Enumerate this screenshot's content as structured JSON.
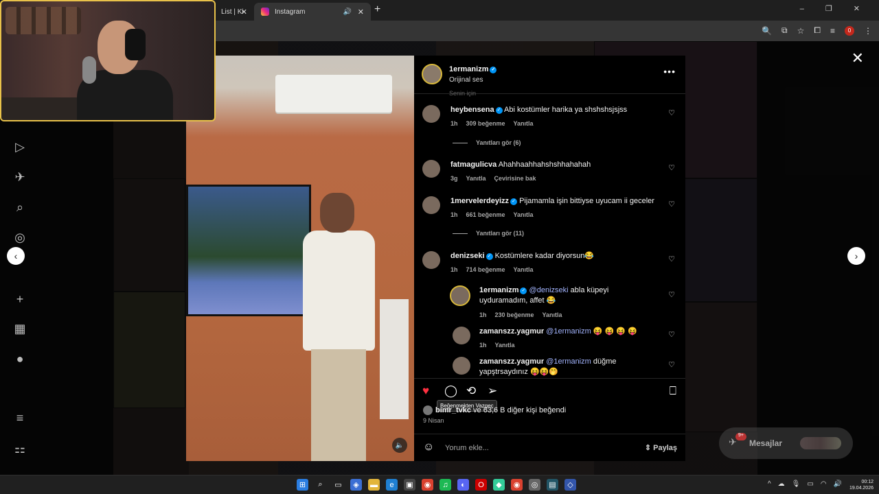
{
  "browser": {
    "tabs": [
      {
        "label": "List | Ki",
        "active": false
      },
      {
        "label": "Instagram",
        "active": true
      }
    ],
    "new_tab": "+",
    "window_controls": "– ❐ ✕",
    "profile_badge": "0"
  },
  "post": {
    "author": "1ermanizm",
    "audio": "Orijinal ses",
    "cut_text": "Senin için",
    "comments": [
      {
        "user": "heybensena",
        "verified": true,
        "text": "Abi kostümler harika ya shshshsjsjss",
        "time": "1h",
        "likes": "309 beğenme",
        "reply": "Yanıtla"
      },
      {
        "replies": "Yanıtları gör (6)"
      },
      {
        "user": "fatmagulicva",
        "verified": false,
        "text": "Ahahhaahhahshshhahahah",
        "time": "3g",
        "reply": "Yanıtla",
        "translate": "Çevirisine bak"
      },
      {
        "user": "1mervelerdeyizz",
        "verified": true,
        "text": "Pijamamla işin bittiyse uyucam ii geceler",
        "time": "1h",
        "likes": "661 beğenme",
        "reply": "Yanıtla"
      },
      {
        "replies": "Yanıtları gör (11)"
      },
      {
        "user": "denizseki",
        "verified": true,
        "text": "Kostümlere kadar diyorsun😂",
        "time": "1h",
        "likes": "714 beğenme",
        "reply": "Yanıtla"
      },
      {
        "user": "1ermanizm",
        "verified": true,
        "mention": "@denizseki",
        "text": "abla küpeyi uyduramadım, affet 😂",
        "time": "1h",
        "likes": "230 beğenme",
        "reply": "Yanıtla"
      },
      {
        "user": "zamanszz.yagmur",
        "verified": false,
        "mention": "@1ermanizm",
        "text": "😝 😝 😝 😝",
        "time": "1h",
        "reply": "Yanıtla"
      },
      {
        "user": "zamanszz.yagmur",
        "verified": false,
        "mention": "@1ermanizm",
        "text": "düğme yapştrsaydınız 😝😝🤭"
      }
    ],
    "tooltip": "Beğenmekten Vazgeç",
    "liked_by_user": "bimr_tvkc",
    "liked_by_rest": " ve 63,6 B diğer kişi beğendi",
    "date": "9 Nisan",
    "comment_placeholder": "Yorum ekle...",
    "share_label": "Paylaş"
  },
  "messages": {
    "label": "Mesajlar",
    "badge": "9+"
  },
  "sidebar_badge": "9+",
  "clock": {
    "time": "00:12",
    "date": "19.04.2026"
  },
  "colors": {
    "like": "#ff3040",
    "verified": "#0095f6",
    "webcam_border": "#e9c24a"
  }
}
